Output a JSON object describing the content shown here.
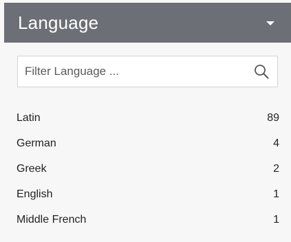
{
  "panel": {
    "title": "Language",
    "toggle_icon": "caret-down-icon"
  },
  "filter": {
    "placeholder": "Filter Language ...",
    "value": "",
    "icon": "search-icon"
  },
  "languages": [
    {
      "label": "Latin",
      "count": "89"
    },
    {
      "label": "German",
      "count": "4"
    },
    {
      "label": "Greek",
      "count": "2"
    },
    {
      "label": "English",
      "count": "1"
    },
    {
      "label": "Middle French",
      "count": "1"
    }
  ],
  "colors": {
    "header_bg": "#6c6f75",
    "header_text": "#ffffff",
    "body_bg": "#f7f7f7"
  }
}
